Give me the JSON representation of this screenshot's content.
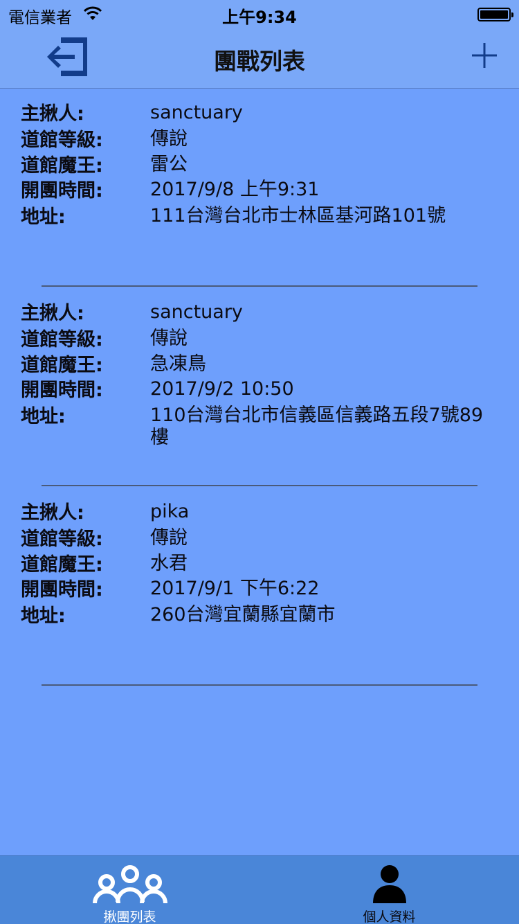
{
  "status": {
    "carrier": "電信業者",
    "time": "上午9:34"
  },
  "nav": {
    "title": "團戰列表",
    "left_icon": "logout-icon",
    "right_icon": "plus-icon"
  },
  "labels": {
    "host": "主揪人:",
    "gym_level": "道館等級:",
    "gym_boss": "道館魔王:",
    "start_time": "開團時間:",
    "address": "地址:"
  },
  "raids": [
    {
      "host": "sanctuary",
      "gym_level": "傳說",
      "gym_boss": "雷公",
      "start_time": "2017/9/8 上午9:31",
      "address": "111台灣台北市士林區基河路101號"
    },
    {
      "host": "sanctuary",
      "gym_level": "傳說",
      "gym_boss": "急凍鳥",
      "start_time": "2017/9/2 10:50",
      "address": "110台灣台北市信義區信義路五段7號89樓"
    },
    {
      "host": "pika",
      "gym_level": "傳說",
      "gym_boss": "水君",
      "start_time": "2017/9/1 下午6:22",
      "address": "260台灣宜蘭縣宜蘭市"
    }
  ],
  "tabs": [
    {
      "label": "揪團列表",
      "icon": "group-icon",
      "selected": true
    },
    {
      "label": "個人資料",
      "icon": "person-icon",
      "selected": false
    }
  ],
  "colors": {
    "background": "#6e9ffc",
    "nav_bar": "#7aa8f8",
    "tab_bar": "#4a86d8",
    "icon_dark_blue": "#123c8a"
  }
}
